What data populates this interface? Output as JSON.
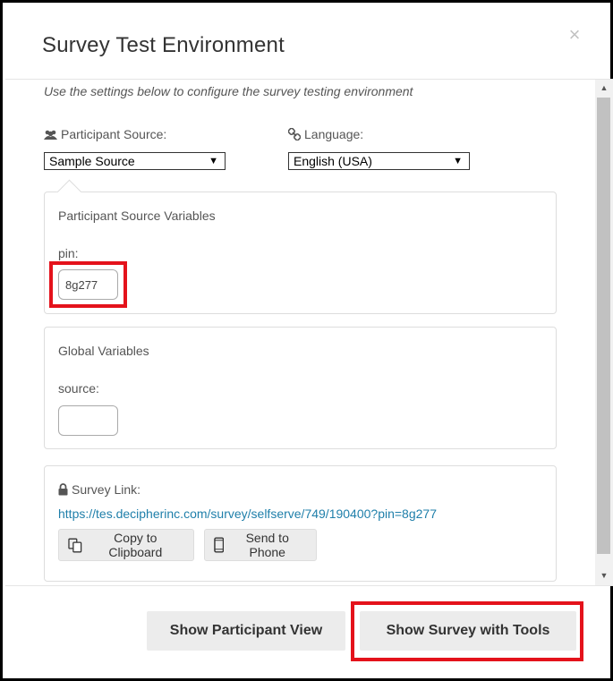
{
  "dialog": {
    "title": "Survey Test Environment",
    "close_label": "×",
    "description": "Use the settings below to configure the survey testing environment"
  },
  "participant_source": {
    "label": "Participant Source:",
    "icon": "users-icon",
    "selected": "Sample Source"
  },
  "language": {
    "label": "Language:",
    "icon": "link-icon",
    "selected": "English (USA)"
  },
  "source_variables": {
    "title": "Participant Source Variables",
    "pin_label": "pin:",
    "pin_value": "8g277"
  },
  "global_variables": {
    "title": "Global Variables",
    "source_label": "source:",
    "source_value": ""
  },
  "survey_link": {
    "label": "Survey Link:",
    "icon": "lock-icon",
    "url": "https://tes.decipherinc.com/survey/selfserve/749/190400?pin=8g277",
    "copy_label": "Copy to Clipboard",
    "phone_label": "Send to Phone"
  },
  "footer": {
    "participant_view_label": "Show Participant View",
    "survey_tools_label": "Show Survey with Tools"
  },
  "colors": {
    "highlight": "#e4121b",
    "link": "#1f7faa"
  }
}
